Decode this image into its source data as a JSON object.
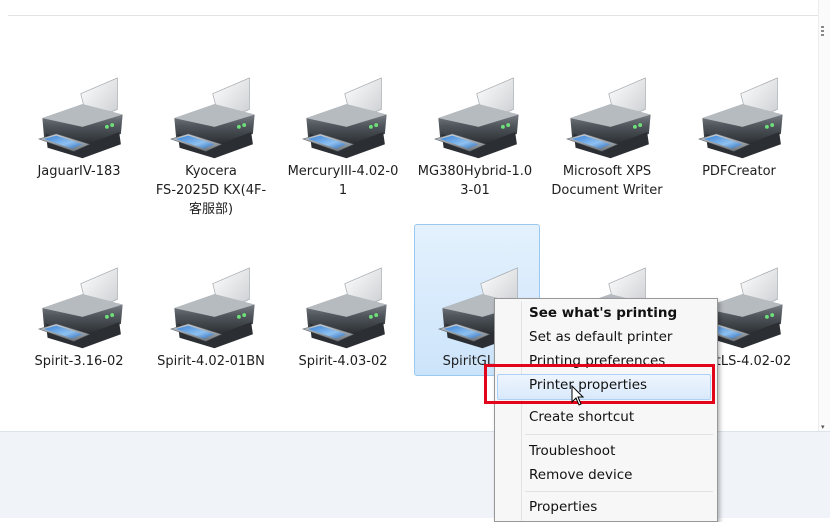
{
  "printers_row1": [
    {
      "label": "JaguarIV-183"
    },
    {
      "label": "Kyocera\nFS-2025D KX(4F-\n客服部)"
    },
    {
      "label": "MercuryIII-4.02-0\n1"
    },
    {
      "label": "MG380Hybrid-1.0\n3-01"
    },
    {
      "label": "Microsoft XPS\nDocument Writer"
    },
    {
      "label": "PDFCreator"
    }
  ],
  "printers_row2": [
    {
      "label": "Spirit-3.16-02"
    },
    {
      "label": "Spirit-4.02-01BN"
    },
    {
      "label": "Spirit-4.03-02"
    },
    {
      "label": "SpiritGLS-3"
    },
    {
      "label": ""
    },
    {
      "label": "SpiritLS-4.02-02"
    }
  ],
  "context_menu": {
    "items": [
      "See what's printing",
      "Set as default printer",
      "Printing preferences",
      "Printer properties",
      "Create shortcut",
      "Troubleshoot",
      "Remove device",
      "Properties"
    ]
  },
  "highlight_color": "#e3061b",
  "selection_color": "#cce4fa"
}
